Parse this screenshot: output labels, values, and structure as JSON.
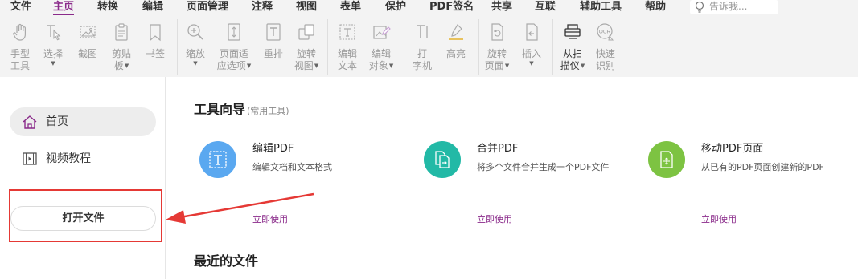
{
  "menu": {
    "items": [
      "文件",
      "主页",
      "转换",
      "编辑",
      "页面管理",
      "注释",
      "视图",
      "表单",
      "保护",
      "PDF签名",
      "共享",
      "互联",
      "辅助工具",
      "帮助"
    ],
    "active": "主页",
    "tell_me_placeholder": "告诉我..."
  },
  "ribbon": {
    "tools": [
      {
        "icon": "hand-icon",
        "label": "手型\n工具"
      },
      {
        "icon": "select-icon",
        "label": "选择"
      },
      {
        "icon": "screenshot-icon",
        "label": "截图"
      },
      {
        "icon": "clipboard-icon",
        "label": "剪贴\n板"
      },
      {
        "icon": "bookmark-icon",
        "label": "书签"
      },
      {
        "icon": "zoom-icon",
        "label": "缩放"
      },
      {
        "icon": "fit-page-icon",
        "label": "页面适\n应选项"
      },
      {
        "icon": "reflow-icon",
        "label": "重排"
      },
      {
        "icon": "rotate-view-icon",
        "label": "旋转\n视图"
      },
      {
        "icon": "edit-text-icon",
        "label": "编辑\n文本"
      },
      {
        "icon": "edit-object-icon",
        "label": "编辑\n对象"
      },
      {
        "icon": "typewriter-icon",
        "label": "打\n字机"
      },
      {
        "icon": "highlight-icon",
        "label": "高亮"
      },
      {
        "icon": "rotate-page-icon",
        "label": "旋转\n页面"
      },
      {
        "icon": "insert-icon",
        "label": "插入"
      },
      {
        "icon": "scanner-icon",
        "label": "从扫\n描仪"
      },
      {
        "icon": "ocr-icon",
        "label": "快速\n识别",
        "badge": "OCR"
      }
    ]
  },
  "sidebar": {
    "items": [
      {
        "label": "首页",
        "icon": "home-icon"
      },
      {
        "label": "视频教程",
        "icon": "video-icon"
      }
    ],
    "open_button": "打开文件"
  },
  "tool_guide": {
    "title": "工具向导",
    "subtitle": "(常用工具)",
    "cards": [
      {
        "title": "编辑PDF",
        "desc": "编辑文档和文本格式",
        "link": "立即使用",
        "icon": "edit-pdf-icon",
        "color": "#5aa8f0"
      },
      {
        "title": "合并PDF",
        "desc": "将多个文件合并生成一个PDF文件",
        "link": "立即使用",
        "icon": "merge-pdf-icon",
        "color": "#22b9a6"
      },
      {
        "title": "移动PDF页面",
        "desc": "从已有的PDF页面创建新的PDF",
        "link": "立即使用",
        "icon": "move-pages-icon",
        "color": "#7dc342"
      }
    ]
  },
  "recent": {
    "title": "最近的文件"
  },
  "colors": {
    "accent": "#8a2a8a",
    "annotation": "#e53935"
  }
}
